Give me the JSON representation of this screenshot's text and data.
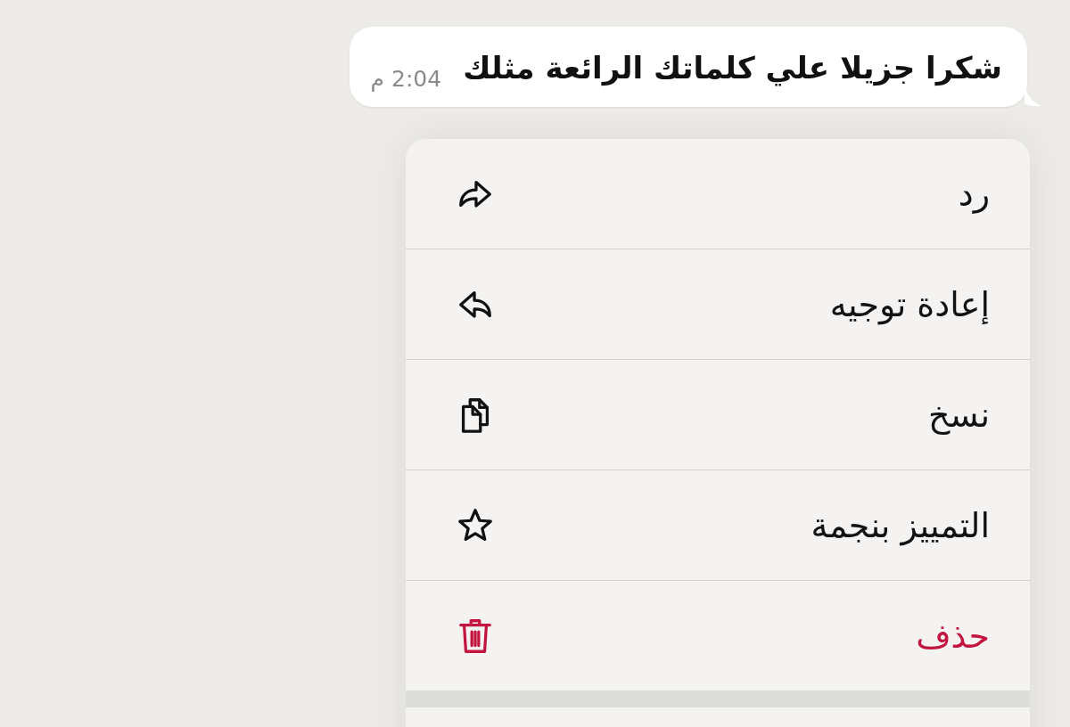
{
  "message": {
    "text": "شكرا جزيلا علي كلماتك الرائعة مثلك",
    "time": "2:04 م"
  },
  "menu": {
    "items": [
      {
        "label": "رد",
        "kind": "reply",
        "destructive": false
      },
      {
        "label": "إعادة توجيه",
        "kind": "forward",
        "destructive": false
      },
      {
        "label": "نسخ",
        "kind": "copy",
        "destructive": false
      },
      {
        "label": "التمييز بنجمة",
        "kind": "star",
        "destructive": false
      },
      {
        "label": "حذف",
        "kind": "delete",
        "destructive": true
      }
    ]
  }
}
